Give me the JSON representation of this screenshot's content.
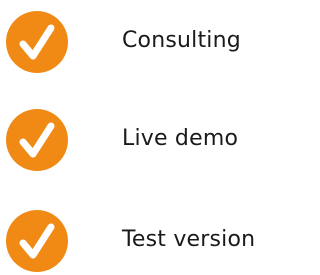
{
  "colors": {
    "badge": "#F08A15",
    "check": "#FFFFFF",
    "text": "#1A1A1A"
  },
  "icon": "checkmark-circle-icon",
  "features": [
    {
      "label": "Consulting"
    },
    {
      "label": "Live demo"
    },
    {
      "label": "Test version"
    }
  ]
}
